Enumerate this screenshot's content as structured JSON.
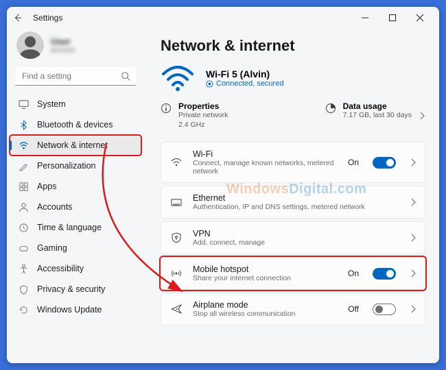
{
  "window": {
    "title": "Settings"
  },
  "profile": {
    "name": "User",
    "sub": "account"
  },
  "search": {
    "placeholder": "Find a setting"
  },
  "sidebar": {
    "items": [
      {
        "label": "System"
      },
      {
        "label": "Bluetooth & devices"
      },
      {
        "label": "Network & internet"
      },
      {
        "label": "Personalization"
      },
      {
        "label": "Apps"
      },
      {
        "label": "Accounts"
      },
      {
        "label": "Time & language"
      },
      {
        "label": "Gaming"
      },
      {
        "label": "Accessibility"
      },
      {
        "label": "Privacy & security"
      },
      {
        "label": "Windows Update"
      }
    ]
  },
  "page": {
    "title": "Network & internet"
  },
  "hero": {
    "title": "Wi-Fi 5 (Alvin)",
    "status": "Connected, secured"
  },
  "info": {
    "properties": {
      "title": "Properties",
      "line1": "Private network",
      "line2": "2.4 GHz"
    },
    "usage": {
      "title": "Data usage",
      "line1": "7.17 GB, last 30 days"
    }
  },
  "cards": {
    "wifi": {
      "title": "Wi-Fi",
      "sub": "Connect, manage known networks, metered network",
      "state": "On"
    },
    "ethernet": {
      "title": "Ethernet",
      "sub": "Authentication, IP and DNS settings, metered network"
    },
    "vpn": {
      "title": "VPN",
      "sub": "Add, connect, manage"
    },
    "hotspot": {
      "title": "Mobile hotspot",
      "sub": "Share your internet connection",
      "state": "On"
    },
    "airplane": {
      "title": "Airplane mode",
      "sub": "Stop all wireless communication",
      "state": "Off"
    }
  },
  "watermark": {
    "part1": "Windows",
    "part2": "Digital.com"
  }
}
